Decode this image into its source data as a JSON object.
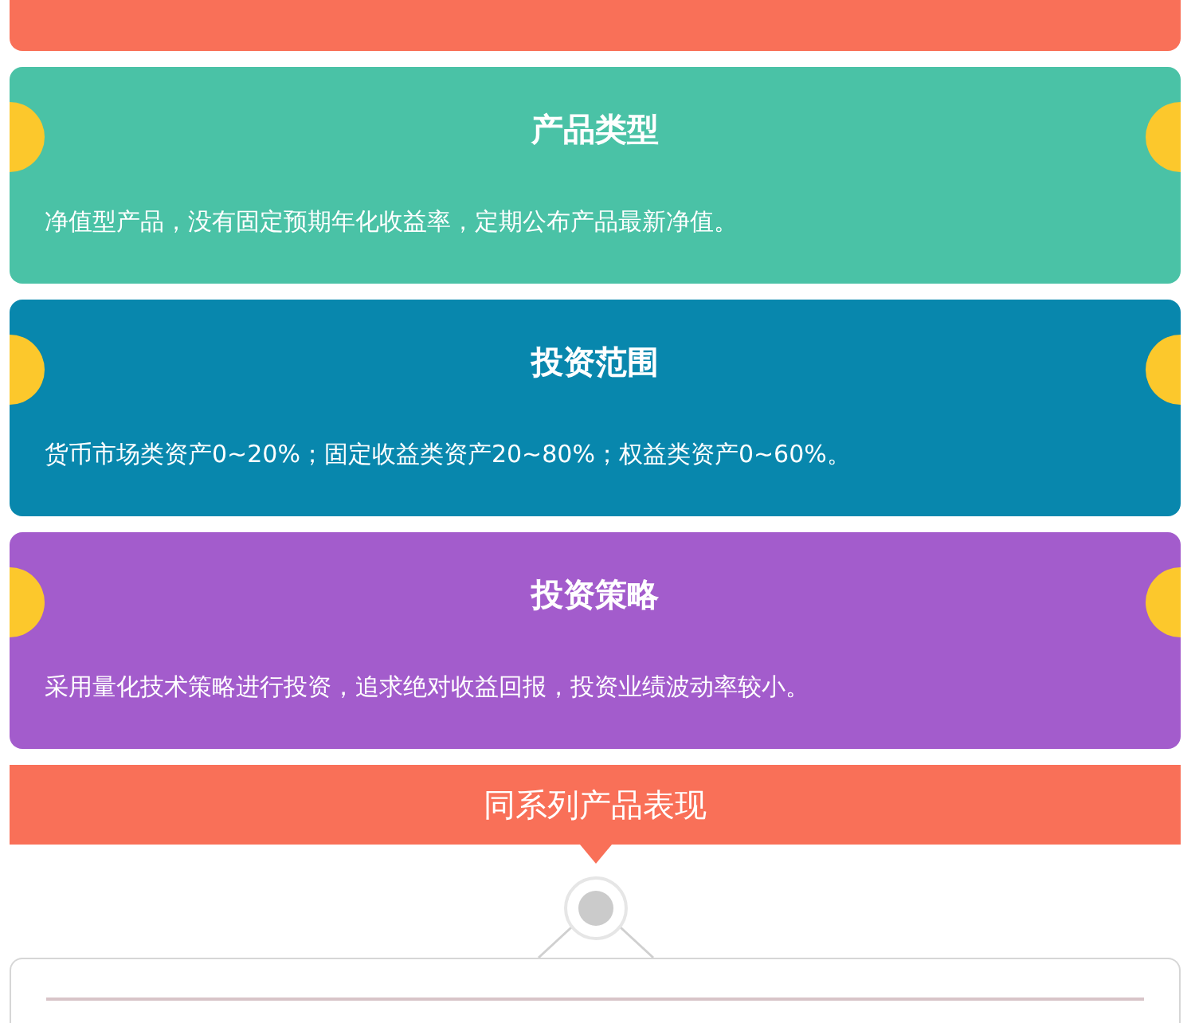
{
  "cards": [
    {
      "title": "产品类型",
      "text": "净值型产品，没有固定预期年化收益率，定期公布产品最新净值。",
      "color": "#4ac2a6"
    },
    {
      "title": "投资范围",
      "text": "货币市场类资产0~20%；固定收益类资产20~80%；权益类资产0~60%。",
      "color": "#0887ad"
    },
    {
      "title": "投资策略",
      "text": "采用量化技术策略进行投资，追求绝对收益回报，投资业绩波动率较小。",
      "color": "#a35ccc"
    }
  ],
  "section_header": {
    "title": "同系列产品表现"
  }
}
